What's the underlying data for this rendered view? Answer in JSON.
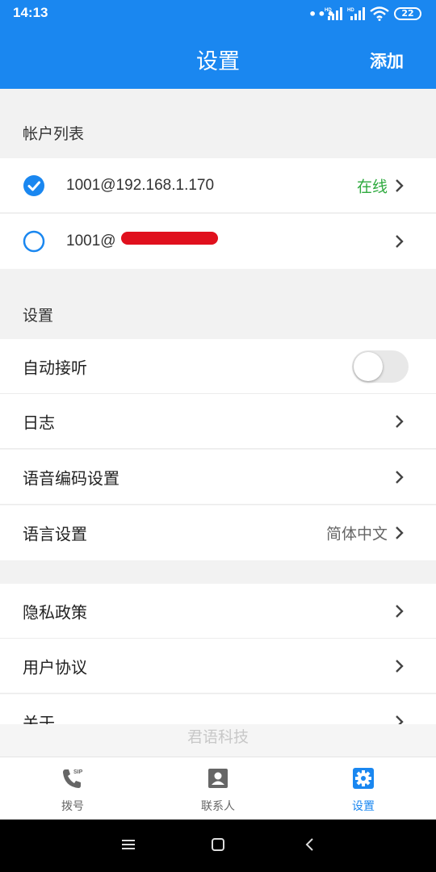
{
  "status_bar": {
    "time": "14:13",
    "dots": "•••",
    "battery": "22"
  },
  "app_bar": {
    "title": "设置",
    "add_label": "添加"
  },
  "accounts": {
    "header": "帐户列表",
    "items": [
      {
        "address": "1001@192.168.1.170",
        "status": "在线",
        "selected": true
      },
      {
        "address": "1001@",
        "status": "",
        "selected": false
      }
    ]
  },
  "settings": {
    "header": "设置",
    "auto_answer": {
      "label": "自动接听",
      "enabled": false
    },
    "log": {
      "label": "日志"
    },
    "codec": {
      "label": "语音编码设置"
    },
    "language": {
      "label": "语言设置",
      "value": "简体中文"
    }
  },
  "other": {
    "privacy": {
      "label": "隐私政策"
    },
    "agreement": {
      "label": "用户协议"
    },
    "about": {
      "label": "关于"
    }
  },
  "brand": "君语科技",
  "tabs": [
    {
      "label": "拨号",
      "icon": "phone-sip-icon",
      "active": false
    },
    {
      "label": "联系人",
      "icon": "contact-card-icon",
      "active": false
    },
    {
      "label": "设置",
      "icon": "gear-icon",
      "active": true
    }
  ],
  "colors": {
    "primary": "#1a87f0",
    "online": "#2eaa3e",
    "background": "#f2f2f2"
  }
}
